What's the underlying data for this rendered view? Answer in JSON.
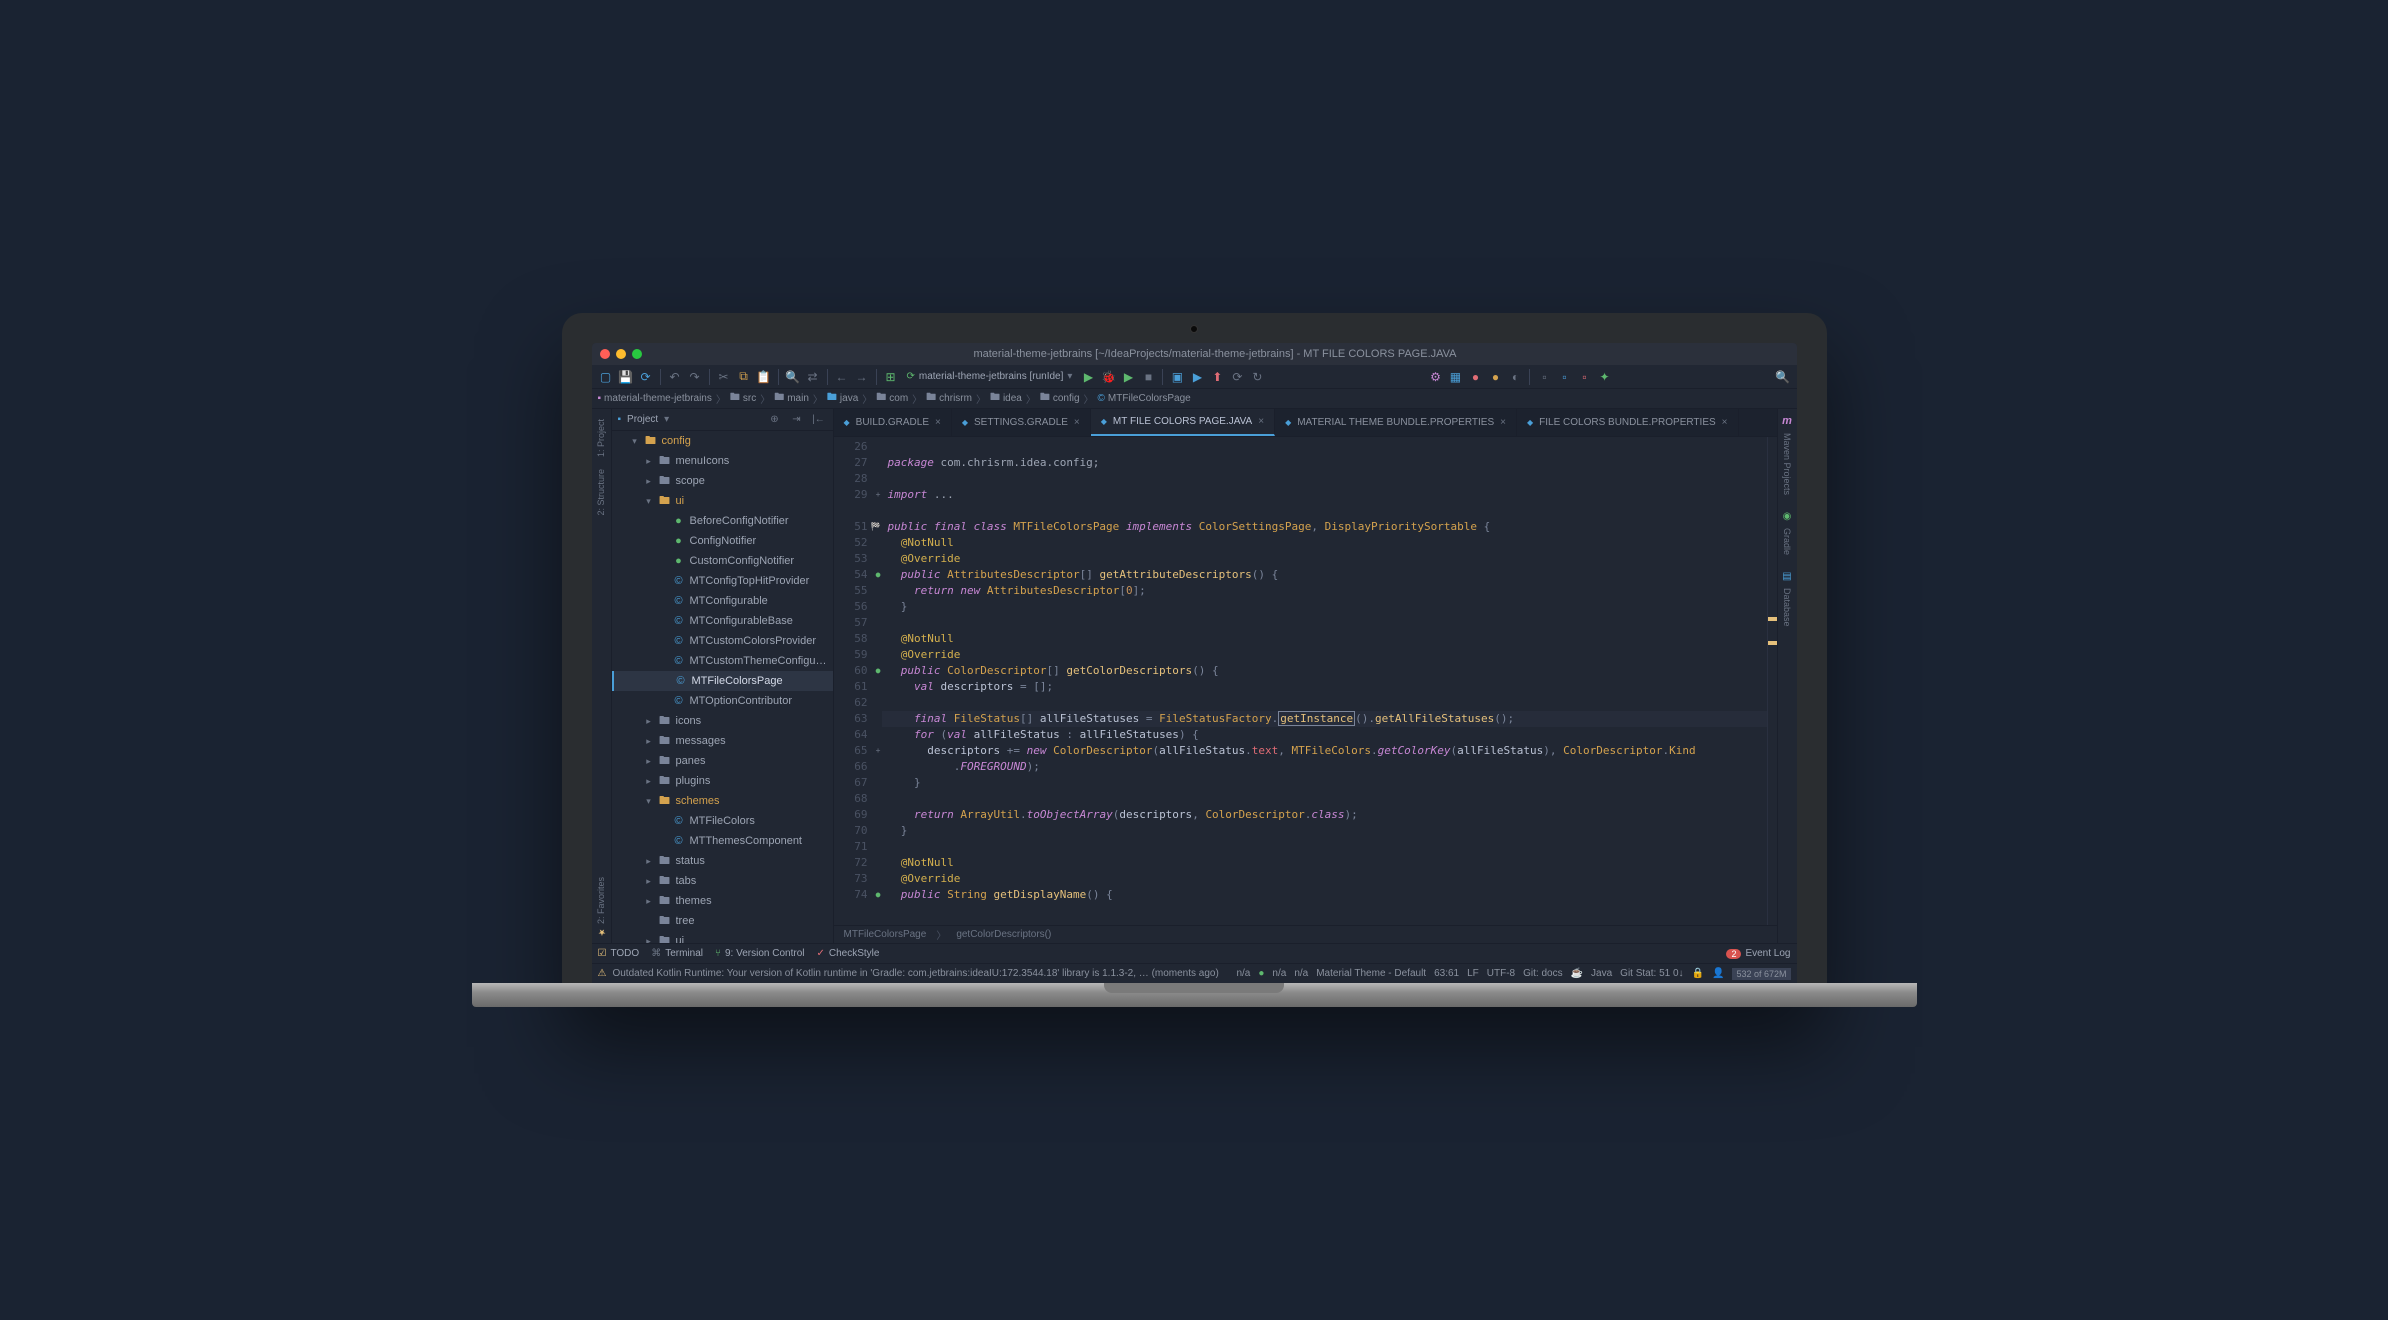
{
  "titlebar": {
    "title": "material-theme-jetbrains [~/IdeaProjects/material-theme-jetbrains] - MT FILE COLORS PAGE.JAVA"
  },
  "toolbar": {
    "run_config": "material-theme-jetbrains [runIde]"
  },
  "breadcrumb": {
    "items": [
      "material-theme-jetbrains",
      "src",
      "main",
      "java",
      "com",
      "chrisrm",
      "idea",
      "config",
      "MTFileColorsPage"
    ]
  },
  "project_header": {
    "label": "Project"
  },
  "project_tree": [
    {
      "depth": 1,
      "type": "folder",
      "open": true,
      "label": "config",
      "chevron": "v"
    },
    {
      "depth": 2,
      "type": "folder",
      "open": false,
      "label": "menuIcons",
      "chevron": ">"
    },
    {
      "depth": 2,
      "type": "folder",
      "open": false,
      "label": "scope",
      "chevron": ">"
    },
    {
      "depth": 2,
      "type": "folder",
      "open": true,
      "label": "ui",
      "chevron": "v"
    },
    {
      "depth": 3,
      "type": "class",
      "label": "BeforeConfigNotifier"
    },
    {
      "depth": 3,
      "type": "class",
      "label": "ConfigNotifier"
    },
    {
      "depth": 3,
      "type": "class",
      "label": "CustomConfigNotifier"
    },
    {
      "depth": 3,
      "type": "java",
      "label": "MTConfigTopHitProvider"
    },
    {
      "depth": 3,
      "type": "java",
      "label": "MTConfigurable"
    },
    {
      "depth": 3,
      "type": "java",
      "label": "MTConfigurableBase"
    },
    {
      "depth": 3,
      "type": "java",
      "label": "MTCustomColorsProvider"
    },
    {
      "depth": 3,
      "type": "java",
      "label": "MTCustomThemeConfigurable"
    },
    {
      "depth": 3,
      "type": "java",
      "label": "MTFileColorsPage",
      "selected": true
    },
    {
      "depth": 3,
      "type": "java",
      "label": "MTOptionContributor"
    },
    {
      "depth": 2,
      "type": "folder",
      "open": false,
      "label": "icons",
      "chevron": ">"
    },
    {
      "depth": 2,
      "type": "folder",
      "open": false,
      "label": "messages",
      "chevron": ">"
    },
    {
      "depth": 2,
      "type": "folder",
      "open": false,
      "label": "panes",
      "chevron": ">"
    },
    {
      "depth": 2,
      "type": "folder",
      "open": false,
      "label": "plugins",
      "chevron": ">"
    },
    {
      "depth": 2,
      "type": "folder",
      "open": true,
      "label": "schemes",
      "chevron": "v"
    },
    {
      "depth": 3,
      "type": "java",
      "label": "MTFileColors"
    },
    {
      "depth": 3,
      "type": "java",
      "label": "MTThemesComponent"
    },
    {
      "depth": 2,
      "type": "folder",
      "open": false,
      "label": "status",
      "chevron": ">"
    },
    {
      "depth": 2,
      "type": "folder",
      "open": false,
      "label": "tabs",
      "chevron": ">"
    },
    {
      "depth": 2,
      "type": "folder",
      "open": false,
      "label": "themes",
      "chevron": ">"
    },
    {
      "depth": 2,
      "type": "folder",
      "open": false,
      "label": "tree",
      "chevron": ""
    },
    {
      "depth": 2,
      "type": "folder",
      "open": false,
      "label": "ui",
      "chevron": ">"
    }
  ],
  "editor_tabs": [
    {
      "label": "BUILD.GRADLE",
      "active": false
    },
    {
      "label": "SETTINGS.GRADLE",
      "active": false
    },
    {
      "label": "MT FILE COLORS PAGE.JAVA",
      "active": true
    },
    {
      "label": "MATERIAL THEME BUNDLE.PROPERTIES",
      "active": false
    },
    {
      "label": "FILE COLORS BUNDLE.PROPERTIES",
      "active": false
    }
  ],
  "code": {
    "line_start": 26,
    "pkg": "com.chrisrm.idea.config",
    "highlighted_method": "getInstance",
    "lines_numbers": [
      "26",
      "27",
      "28",
      "29",
      "",
      "51",
      "52",
      "53",
      "54",
      "55",
      "56",
      "57",
      "58",
      "59",
      "60",
      "61",
      "62",
      "63",
      "64",
      "65",
      "66",
      "67",
      "68",
      "69",
      "70",
      "71",
      "72",
      "73",
      "74"
    ]
  },
  "editor_crumb": {
    "class": "MTFileColorsPage",
    "method": "getColorDescriptors()"
  },
  "left_tabs": [
    "1: Project",
    "2: Structure",
    "2: Favorites"
  ],
  "right_tabs": [
    "Maven Projects",
    "Gradle",
    "Database"
  ],
  "bottom_toolbar": {
    "todo": "TODO",
    "terminal": "Terminal",
    "vcs": "9: Version Control",
    "checkstyle": "CheckStyle",
    "event_log": "Event Log",
    "event_count": "2"
  },
  "status": {
    "message": "Outdated Kotlin Runtime: Your version of Kotlin runtime in 'Gradle: com.jetbrains:ideaIU:172.3544.18' library is 1.1.3-2, … (moments ago)",
    "na1": "n/a",
    "na2": "n/a",
    "na3": "n/a",
    "theme": "Material Theme - Default",
    "pos": "63:61",
    "lf": "LF",
    "enc": "UTF-8",
    "git": "Git: docs",
    "lang": "Java",
    "gitstat": "Git Stat: 51 0↓",
    "mem": "532 of 672M"
  }
}
